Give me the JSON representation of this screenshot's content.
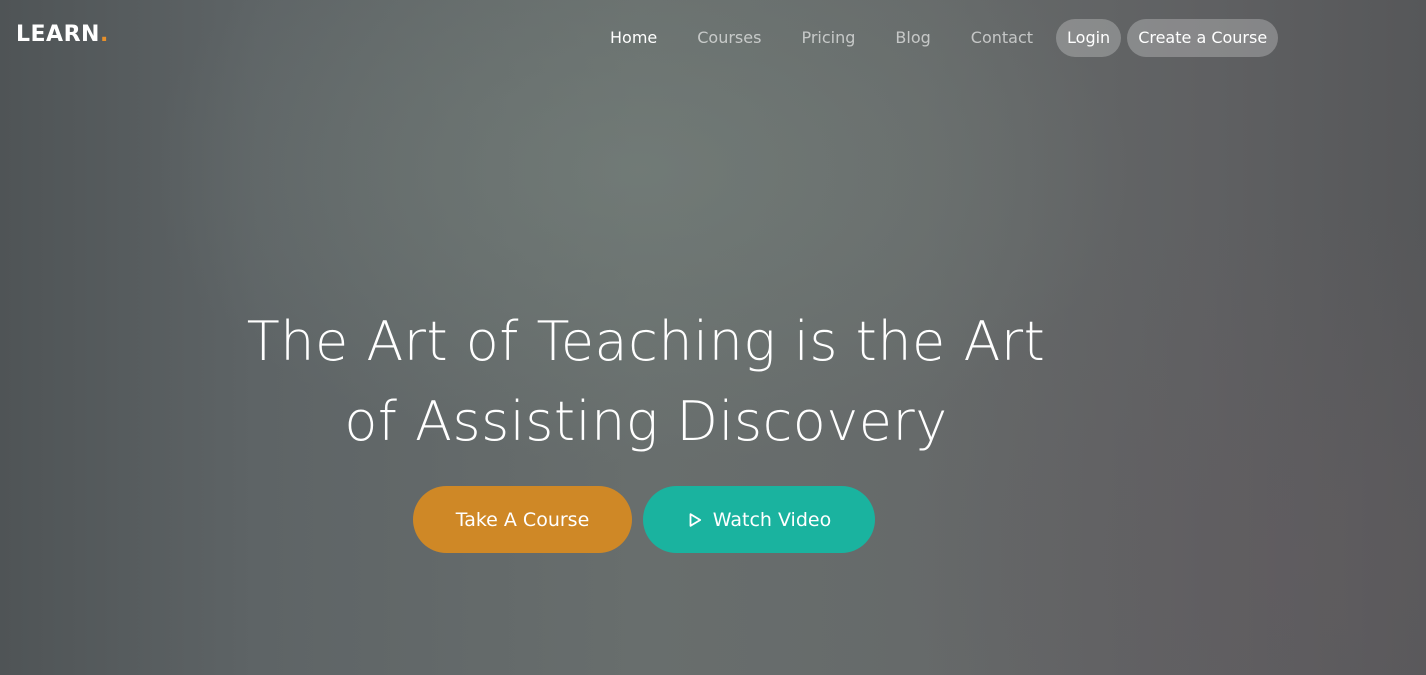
{
  "brand": {
    "name": "LEARN",
    "dot": "."
  },
  "nav": {
    "items": [
      {
        "label": "Home"
      },
      {
        "label": "Courses"
      },
      {
        "label": "Pricing"
      },
      {
        "label": "Blog"
      },
      {
        "label": "Contact"
      }
    ],
    "login_label": "Login",
    "create_course_label": "Create a Course"
  },
  "hero": {
    "title_line1": "The Art of Teaching is the Art",
    "title_line2": "of Assisting Discovery",
    "take_course_label": "Take A Course",
    "watch_video_label": "Watch Video"
  },
  "colors": {
    "brand_dot": "#e8902a",
    "take_course_button": "#cf8826",
    "watch_video_button": "#1ab39f"
  },
  "icons": {
    "watch_video": "play-icon"
  }
}
